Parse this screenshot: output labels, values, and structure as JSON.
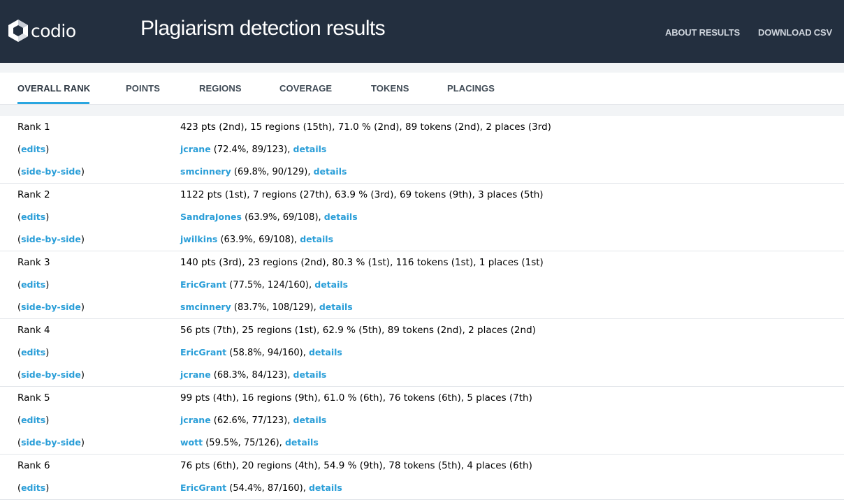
{
  "header": {
    "logo_text": "codio",
    "title": "Plagiarism detection results",
    "nav": [
      "ABOUT RESULTS",
      "DOWNLOAD CSV"
    ]
  },
  "tabs": [
    "OVERALL RANK",
    "POINTS",
    "REGIONS",
    "COVERAGE",
    "TOKENS",
    "PLACINGS"
  ],
  "active_tab": "OVERALL RANK",
  "labels": {
    "edits": "edits",
    "side_by_side": "side-by-side",
    "details": "details"
  },
  "ranks": [
    {
      "rank": "Rank 1",
      "summary": "423 pts (2nd), 15 regions (15th), 71.0 % (2nd), 89 tokens (2nd), 2 places (3rd)",
      "users": [
        {
          "name": "jcrane",
          "stats": " (72.4%, 89/123), "
        },
        {
          "name": "smcinnery",
          "stats": " (69.8%, 90/129), "
        }
      ]
    },
    {
      "rank": "Rank 2",
      "summary": "1122 pts (1st), 7 regions (27th), 63.9 % (3rd), 69 tokens (9th), 3 places (5th)",
      "users": [
        {
          "name": "SandraJones",
          "stats": " (63.9%, 69/108), "
        },
        {
          "name": "jwilkins",
          "stats": " (63.9%, 69/108), "
        }
      ]
    },
    {
      "rank": "Rank 3",
      "summary": "140 pts (3rd), 23 regions (2nd), 80.3 % (1st), 116 tokens (1st), 1 places (1st)",
      "users": [
        {
          "name": "EricGrant",
          "stats": " (77.5%, 124/160), "
        },
        {
          "name": "smcinnery",
          "stats": " (83.7%, 108/129), "
        }
      ]
    },
    {
      "rank": "Rank 4",
      "summary": "56 pts (7th), 25 regions (1st), 62.9 % (5th), 89 tokens (2nd), 2 places (2nd)",
      "users": [
        {
          "name": "EricGrant",
          "stats": " (58.8%, 94/160), "
        },
        {
          "name": "jcrane",
          "stats": " (68.3%, 84/123), "
        }
      ]
    },
    {
      "rank": "Rank 5",
      "summary": "99 pts (4th), 16 regions (9th), 61.0 % (6th), 76 tokens (6th), 5 places (7th)",
      "users": [
        {
          "name": "jcrane",
          "stats": " (62.6%, 77/123), "
        },
        {
          "name": "wott",
          "stats": " (59.5%, 75/126), "
        }
      ]
    },
    {
      "rank": "Rank 6",
      "summary": "76 pts (6th), 20 regions (4th), 54.9 % (9th), 78 tokens (5th), 4 places (6th)",
      "users": [
        {
          "name": "EricGrant",
          "stats": " (54.4%, 87/160), "
        }
      ]
    }
  ],
  "colors": {
    "header_bg": "#232f3f",
    "accent": "#2aa6e0",
    "link": "#2a9ed8"
  }
}
